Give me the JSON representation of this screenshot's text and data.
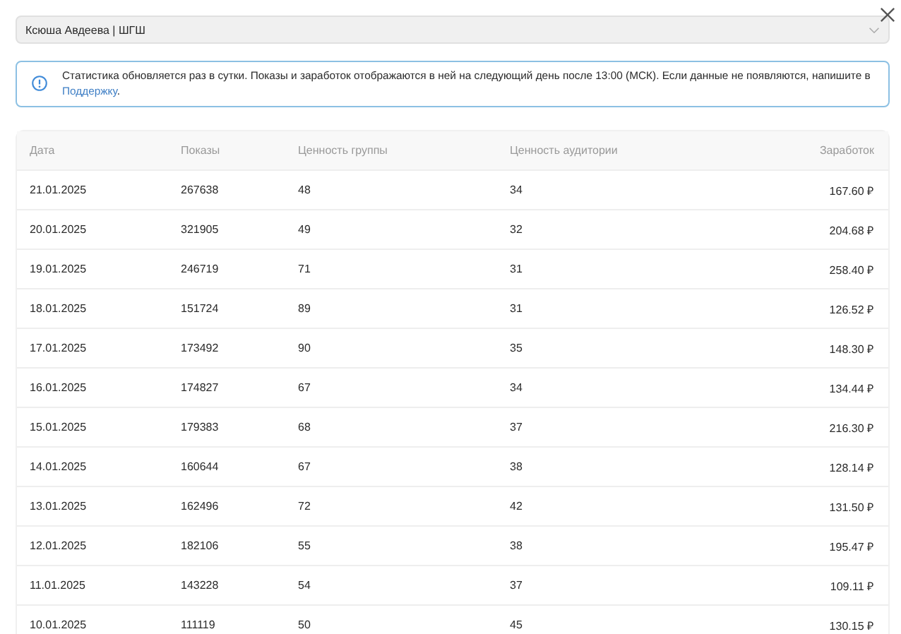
{
  "select": {
    "value": "Ксюша Авдеева | ШГШ"
  },
  "notice": {
    "text": "Статистика обновляется раз в сутки. Показы и заработок отображаются в ней на следующий день после 13:00 (МСК). Если данные не появляются, напишите в ",
    "link": "Поддержку",
    "after": "."
  },
  "table": {
    "columns": [
      "Дата",
      "Показы",
      "Ценность группы",
      "Ценность аудитории",
      "Заработок"
    ],
    "rows": [
      [
        "21.01.2025",
        "267638",
        "48",
        "34",
        "167.60 ₽"
      ],
      [
        "20.01.2025",
        "321905",
        "49",
        "32",
        "204.68 ₽"
      ],
      [
        "19.01.2025",
        "246719",
        "71",
        "31",
        "258.40 ₽"
      ],
      [
        "18.01.2025",
        "151724",
        "89",
        "31",
        "126.52 ₽"
      ],
      [
        "17.01.2025",
        "173492",
        "90",
        "35",
        "148.30 ₽"
      ],
      [
        "16.01.2025",
        "174827",
        "67",
        "34",
        "134.44 ₽"
      ],
      [
        "15.01.2025",
        "179383",
        "68",
        "37",
        "216.30 ₽"
      ],
      [
        "14.01.2025",
        "160644",
        "67",
        "38",
        "128.14 ₽"
      ],
      [
        "13.01.2025",
        "162496",
        "72",
        "42",
        "131.50 ₽"
      ],
      [
        "12.01.2025",
        "182106",
        "55",
        "38",
        "195.47 ₽"
      ],
      [
        "11.01.2025",
        "143228",
        "54",
        "37",
        "109.11 ₽"
      ],
      [
        "10.01.2025",
        "111119",
        "50",
        "45",
        "130.15 ₽"
      ]
    ]
  }
}
